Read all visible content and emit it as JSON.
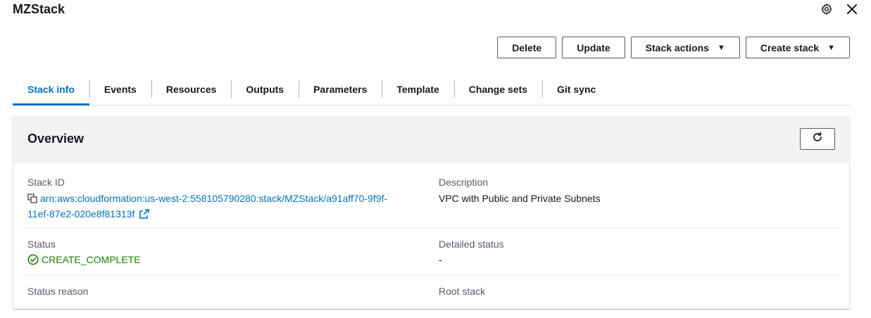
{
  "stack": {
    "name": "MZStack"
  },
  "actions": {
    "delete": "Delete",
    "update": "Update",
    "stack_actions": "Stack actions",
    "create_stack": "Create stack"
  },
  "tabs": [
    {
      "label": "Stack info",
      "active": true
    },
    {
      "label": "Events"
    },
    {
      "label": "Resources"
    },
    {
      "label": "Outputs"
    },
    {
      "label": "Parameters"
    },
    {
      "label": "Template"
    },
    {
      "label": "Change sets"
    },
    {
      "label": "Git sync"
    }
  ],
  "overview": {
    "title": "Overview",
    "stack_id_label": "Stack ID",
    "stack_id_line1": "arn:aws:cloudformation:us-west-2:558105790280:stack/MZStack/a91aff70-9f9f-",
    "stack_id_line2": "11ef-87e2-020e8f81313f",
    "description_label": "Description",
    "description_value": "VPC with Public and Private Subnets",
    "status_label": "Status",
    "status_value": "CREATE_COMPLETE",
    "detailed_status_label": "Detailed status",
    "detailed_status_value": "-",
    "status_reason_label": "Status reason",
    "root_stack_label": "Root stack"
  },
  "colors": {
    "accent": "#0073bb",
    "success": "#1d8102"
  },
  "icons": [
    "settings-gear-icon",
    "close-icon",
    "caret-down-icon",
    "refresh-icon",
    "copy-icon",
    "external-link-icon",
    "status-check-icon"
  ]
}
